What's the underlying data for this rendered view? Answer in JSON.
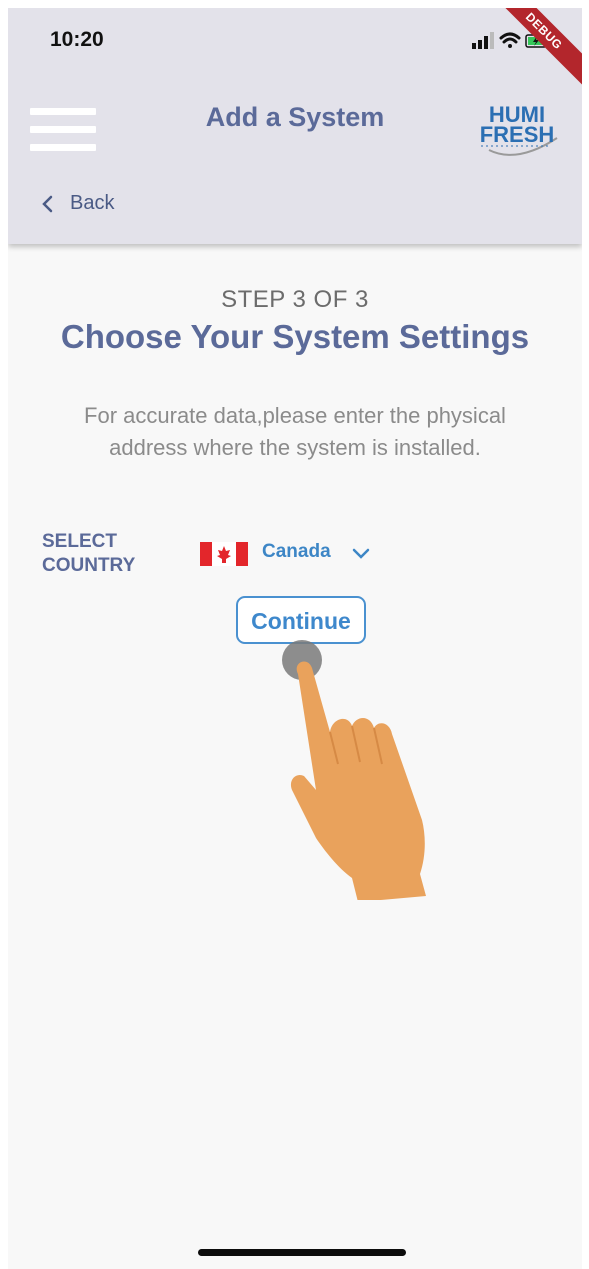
{
  "status_bar": {
    "time": "10:20",
    "icons": [
      "signal-icon",
      "wifi-icon",
      "battery-charging-icon"
    ],
    "debug_banner": "DEBUG"
  },
  "app_bar": {
    "title": "Add a System",
    "logo_line1": "HUMI",
    "logo_line2": "FRESH",
    "back_label": "Back"
  },
  "main": {
    "step": "STEP 3 OF 3",
    "heading": "Choose Your System Settings",
    "description": "For accurate data,please enter the physical address where the system is installed.",
    "country_label_line1": "SELECT",
    "country_label_line2": "COUNTRY",
    "country_value": "Canada",
    "continue_label": "Continue"
  },
  "colors": {
    "accent": "#5b6a99",
    "link": "#3d86c6",
    "appbar_bg": "#e3e2ea",
    "hand": "#e9a25c"
  }
}
